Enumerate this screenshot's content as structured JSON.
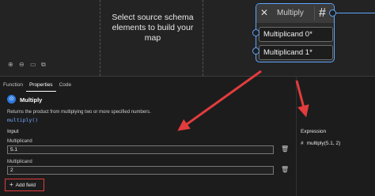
{
  "canvas": {
    "message": "Select source schema elements to build your map",
    "tool_icons": [
      "zoom-in-icon",
      "zoom-out-icon",
      "fit-to-screen-icon",
      "minimap-icon"
    ]
  },
  "function_card": {
    "title": "Multiply",
    "symbol": "#",
    "inputs": [
      "Multiplicand 0*",
      "Multiplicand 1*"
    ],
    "accent_color": "#5aa7ff"
  },
  "panel": {
    "tabs": [
      "Function",
      "Properties",
      "Code"
    ],
    "active_tab": "Properties",
    "function_name": "Multiply",
    "function_description": "Returns the product from multiplying two or more specified numbers.",
    "function_signature": "multiply()",
    "input_section_label": "Input",
    "fields": [
      {
        "label": "Multiplicand",
        "value": "5.1"
      },
      {
        "label": "Multiplicand",
        "value": "2"
      }
    ],
    "add_field_label": "Add field",
    "expression_label": "Expression",
    "expression_value": "multiply(5.1, 2)"
  },
  "annotation_color": "#e23c3c"
}
